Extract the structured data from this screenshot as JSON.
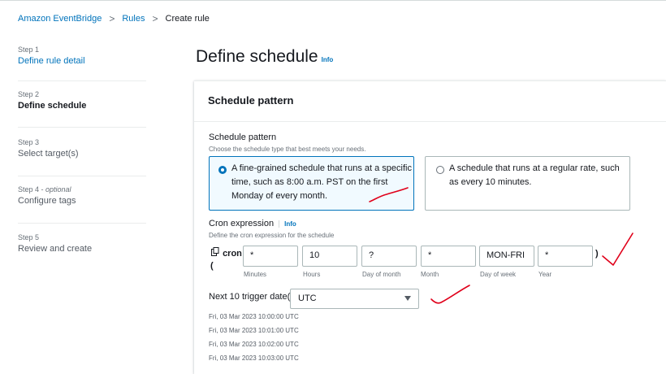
{
  "breadcrumb": {
    "items": [
      "Amazon EventBridge",
      "Rules",
      "Create rule"
    ]
  },
  "steps": [
    {
      "num": "Step 1",
      "title": "Define rule detail"
    },
    {
      "num": "Step 2",
      "title": "Define schedule"
    },
    {
      "num": "Step 3",
      "title": "Select target(s)"
    },
    {
      "num_prefix": "Step 4 - ",
      "num_optional": "optional",
      "title": "Configure tags"
    },
    {
      "num": "Step 5",
      "title": "Review and create"
    }
  ],
  "page": {
    "title": "Define schedule",
    "info": "Info"
  },
  "panel": {
    "heading": "Schedule pattern",
    "pattern_label": "Schedule pattern",
    "pattern_desc": "Choose the schedule type that best meets your needs.",
    "option_cron": "A fine-grained schedule that runs at a specific time, such as 8:00 a.m. PST on the first Monday of every month.",
    "option_rate": "A schedule that runs at a regular rate, such as every 10 minutes.",
    "cron_label": "Cron expression",
    "cron_info": "Info",
    "cron_desc": "Define the cron expression for the schedule",
    "cron_prefix": "cron",
    "paren_open": "(",
    "paren_close": ")",
    "fields": [
      {
        "value": "*",
        "caption": "Minutes"
      },
      {
        "value": "10",
        "caption": "Hours"
      },
      {
        "value": "?",
        "caption": "Day of month"
      },
      {
        "value": "*",
        "caption": "Month"
      },
      {
        "value": "MON-FRI",
        "caption": "Day of week"
      },
      {
        "value": "*",
        "caption": "Year"
      }
    ],
    "next_label": "Next 10 trigger date(s)",
    "timezone": "UTC",
    "trigger_dates": [
      "Fri, 03 Mar 2023 10:00:00 UTC",
      "Fri, 03 Mar 2023 10:01:00 UTC",
      "Fri, 03 Mar 2023 10:02:00 UTC",
      "Fri, 03 Mar 2023 10:03:00 UTC"
    ]
  },
  "colors": {
    "link": "#0073bb",
    "annotation": "#e0001a"
  }
}
